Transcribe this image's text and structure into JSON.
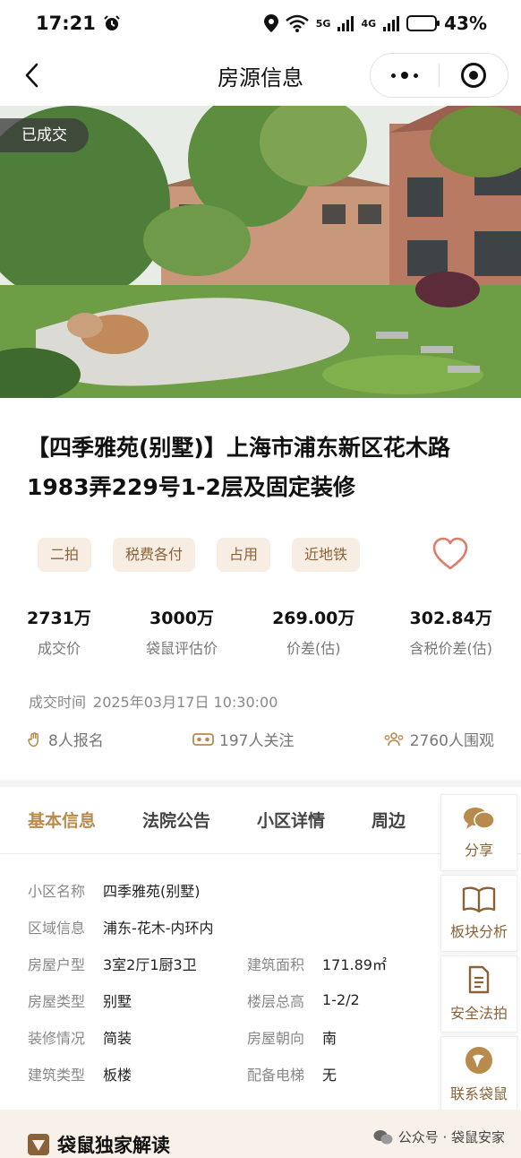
{
  "status": {
    "time": "17:21",
    "network_a": "5G",
    "network_b": "4G",
    "battery": "43%",
    "battery_level": 0.43
  },
  "nav": {
    "title": "房源信息"
  },
  "hero": {
    "badge": "已成交"
  },
  "listing": {
    "title": "【四季雅苑(别墅)】上海市浦东新区花木路1983弄229号1-2层及固定装修",
    "tags": [
      "二拍",
      "税费各付",
      "占用",
      "近地铁"
    ]
  },
  "stats": [
    {
      "value": "2731万",
      "label": "成交价"
    },
    {
      "value": "3000万",
      "label": "袋鼠评估价"
    },
    {
      "value": "269.00万",
      "label": "价差(估)"
    },
    {
      "value": "302.84万",
      "label": "含税价差(估)"
    }
  ],
  "deal": {
    "label": "成交时间",
    "value": "2025年03月17日 10:30:00"
  },
  "meta": {
    "signups": "8人报名",
    "followers": "197人关注",
    "viewers": "2760人围观"
  },
  "tabs": [
    "基本信息",
    "法院公告",
    "小区详情",
    "周边"
  ],
  "info": {
    "community": {
      "k": "小区名称",
      "v": "四季雅苑(别墅)"
    },
    "area": {
      "k": "区域信息",
      "v": "浦东-花木-内环内"
    },
    "layout": {
      "k": "房屋户型",
      "v": "3室2厅1厨3卫"
    },
    "build_area": {
      "k": "建筑面积",
      "v": "171.89㎡"
    },
    "house_type": {
      "k": "房屋类型",
      "v": "别墅"
    },
    "floors": {
      "k": "楼层总高",
      "v": "1-2/2"
    },
    "decoration": {
      "k": "装修情况",
      "v": "简装"
    },
    "orientation": {
      "k": "房屋朝向",
      "v": "南"
    },
    "structure": {
      "k": "建筑类型",
      "v": "板楼"
    },
    "elevator": {
      "k": "配备电梯",
      "v": "无"
    }
  },
  "side": {
    "share": "分享",
    "analysis": "板块分析",
    "safe": "安全法拍",
    "contact": "联系袋鼠"
  },
  "bottom": {
    "title": "袋鼠独家解读",
    "watermark": "公众号 · 袋鼠安家"
  },
  "colors": {
    "accent": "#b88a4c",
    "tag_bg": "#f7ede3",
    "heart": "#e07b6b"
  }
}
